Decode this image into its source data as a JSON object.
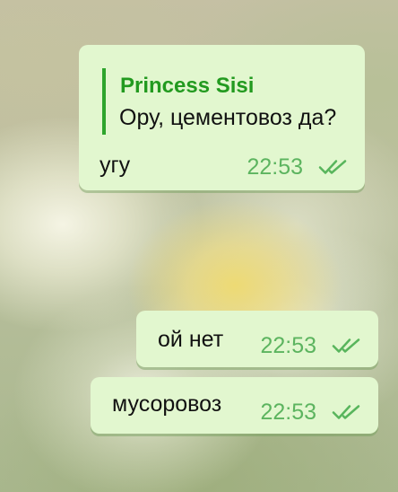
{
  "chat": {
    "messages": [
      {
        "reply": {
          "author": "Princess Sisi",
          "text": "Ору, цементовоз да?"
        },
        "text": "угу",
        "time": "22:53",
        "status_icon": "double-check-icon"
      },
      {
        "text": "ой нет",
        "time": "22:53",
        "status_icon": "double-check-icon"
      },
      {
        "text": "мусоровоз",
        "time": "22:53",
        "status_icon": "double-check-icon"
      }
    ]
  },
  "colors": {
    "bubble_background": "#e2f7cf",
    "reply_accent": "#2ea52c",
    "time_text": "#5cb45f",
    "status_icon": "#58b55c"
  }
}
